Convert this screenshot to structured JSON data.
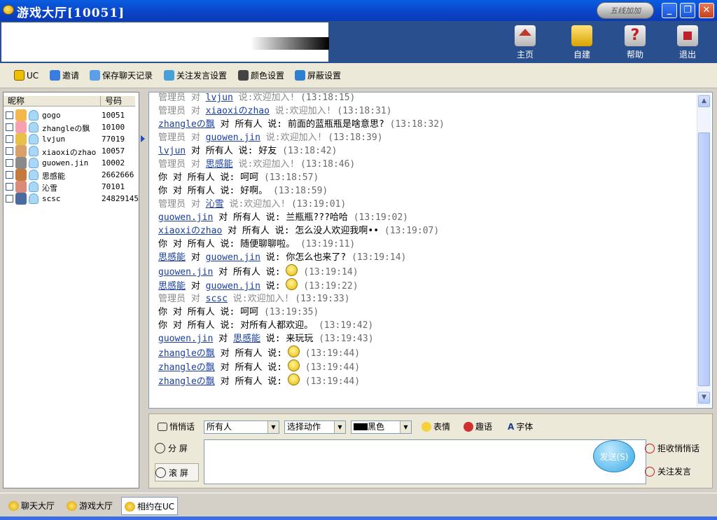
{
  "window": {
    "title": "游戏大厅[10051]",
    "brand": "五线加加",
    "minimize": "_",
    "maximize": "❐",
    "close": "✕"
  },
  "nav": [
    {
      "label": "主页",
      "icon": "home-icon"
    },
    {
      "label": "自建",
      "icon": "create-icon"
    },
    {
      "label": "帮助",
      "icon": "help-icon"
    },
    {
      "label": "退出",
      "icon": "exit-icon"
    }
  ],
  "toolbar": {
    "uc": "UC",
    "invite": "邀请",
    "save_chat": "保存聊天记录",
    "follow_settings": "关注发言设置",
    "color_settings": "颜色设置",
    "block_settings": "屏蔽设置"
  },
  "userlist": {
    "col_nick": "昵称",
    "col_id": "号码",
    "users": [
      {
        "name": "gogo",
        "id": "10051"
      },
      {
        "name": "zhangleの飘",
        "id": "10100"
      },
      {
        "name": "lvjun",
        "id": "77019"
      },
      {
        "name": "xiaoxiのzhao",
        "id": "10057"
      },
      {
        "name": "guowen.jin",
        "id": "10002"
      },
      {
        "name": "思感能",
        "id": "2662666"
      },
      {
        "name": "沁雪",
        "id": "70101"
      },
      {
        "name": "scsc",
        "id": "24829145"
      }
    ]
  },
  "chat": {
    "messages": [
      {
        "sys": true,
        "pre": "管理员 对 ",
        "user": "lvjun",
        "mid": "",
        "target": "",
        "text": " 说:欢迎加入!",
        "emoji": false,
        "time": "(13:18:15)"
      },
      {
        "sys": true,
        "pre": "管理员 对 ",
        "user": "xiaoxiのzhao",
        "mid": "",
        "target": "",
        "text": " 说:欢迎加入!",
        "emoji": false,
        "time": "(13:18:31)"
      },
      {
        "sys": false,
        "pre": "",
        "user": "zhangleの飘",
        "mid": " 对 所有人 说: ",
        "target": "",
        "text": "前面的蓝瓶瓶是啥意思?",
        "emoji": false,
        "time": "(13:18:32)"
      },
      {
        "sys": true,
        "pre": "管理员 对 ",
        "user": "guowen.jin",
        "mid": "",
        "target": "",
        "text": " 说:欢迎加入!",
        "emoji": false,
        "time": "(13:18:39)"
      },
      {
        "sys": false,
        "pre": "",
        "user": "lvjun",
        "mid": " 对 所有人 说: ",
        "target": "",
        "text": "好友",
        "emoji": false,
        "time": "(13:18:42)"
      },
      {
        "sys": true,
        "pre": "管理员 对 ",
        "user": "思感能",
        "mid": "",
        "target": "",
        "text": " 说:欢迎加入!",
        "emoji": false,
        "time": "(13:18:46)"
      },
      {
        "sys": false,
        "pre": "你 对 所有人 说: ",
        "user": "",
        "mid": "",
        "target": "",
        "text": "呵呵",
        "emoji": false,
        "time": "(13:18:57)"
      },
      {
        "sys": false,
        "pre": "你 对 所有人 说: ",
        "user": "",
        "mid": "",
        "target": "",
        "text": "好啊。",
        "emoji": false,
        "time": "(13:18:59)"
      },
      {
        "sys": true,
        "pre": "管理员 对 ",
        "user": "沁雪",
        "mid": "",
        "target": "",
        "text": " 说:欢迎加入!",
        "emoji": false,
        "time": "(13:19:01)"
      },
      {
        "sys": false,
        "pre": "",
        "user": "guowen.jin",
        "mid": " 对 所有人 说: ",
        "target": "",
        "text": "兰瓶瓶???哈哈",
        "emoji": false,
        "time": "(13:19:02)"
      },
      {
        "sys": false,
        "pre": "",
        "user": "xiaoxiのzhao",
        "mid": " 对 所有人 说: ",
        "target": "",
        "text": "怎么没人欢迎我啊••",
        "emoji": false,
        "time": "(13:19:07)"
      },
      {
        "sys": false,
        "pre": "你 对 所有人 说: ",
        "user": "",
        "mid": "",
        "target": "",
        "text": "随便聊聊啦。",
        "emoji": false,
        "time": "(13:19:11)"
      },
      {
        "sys": false,
        "pre": "",
        "user": "思感能",
        "mid": " 对 ",
        "target": "guowen.jin",
        "text": " 说: 你怎么也来了?",
        "emoji": false,
        "time": "(13:19:14)"
      },
      {
        "sys": false,
        "pre": "",
        "user": "guowen.jin",
        "mid": " 对 所有人 说: ",
        "target": "",
        "text": "",
        "emoji": true,
        "time": "(13:19:14)"
      },
      {
        "sys": false,
        "pre": "",
        "user": "思感能",
        "mid": " 对 ",
        "target": "guowen.jin",
        "text": " 说: ",
        "emoji": true,
        "time": "(13:19:22)"
      },
      {
        "sys": true,
        "pre": "管理员 对 ",
        "user": "scsc",
        "mid": "",
        "target": "",
        "text": " 说:欢迎加入!",
        "emoji": false,
        "time": "(13:19:33)"
      },
      {
        "sys": false,
        "pre": "你 对 所有人 说: ",
        "user": "",
        "mid": "",
        "target": "",
        "text": "呵呵",
        "emoji": false,
        "time": "(13:19:35)"
      },
      {
        "sys": false,
        "pre": "你 对 所有人 说: ",
        "user": "",
        "mid": "",
        "target": "",
        "text": "对所有人都欢迎。",
        "emoji": false,
        "time": "(13:19:42)"
      },
      {
        "sys": false,
        "pre": "",
        "user": "guowen.jin",
        "mid": " 对 ",
        "target": "思感能",
        "text": " 说: 来玩玩",
        "emoji": false,
        "time": "(13:19:43)"
      },
      {
        "sys": false,
        "pre": "",
        "user": "zhangleの飘",
        "mid": " 对 所有人 说: ",
        "target": "",
        "text": "",
        "emoji": true,
        "time": "(13:19:44)"
      },
      {
        "sys": false,
        "pre": "",
        "user": "zhangleの飘",
        "mid": " 对 所有人 说: ",
        "target": "",
        "text": "",
        "emoji": true,
        "time": "(13:19:44)"
      },
      {
        "sys": false,
        "pre": "",
        "user": "zhangleの飘",
        "mid": " 对 所有人 说: ",
        "target": "",
        "text": "",
        "emoji": true,
        "time": "(13:19:44)"
      }
    ]
  },
  "input": {
    "whisper": "悄悄话",
    "recipient": "所有人",
    "action": "选择动作",
    "color": "黑色",
    "emoticon": "表情",
    "fun": "趣语",
    "font": "字体",
    "split_screen": "分  屏",
    "scroll_screen": "滚  屏",
    "send": "发送(S)",
    "reject_whisper": "拒收悄悄话",
    "follow_speech": "关注发言",
    "message": ""
  },
  "taskbar": [
    {
      "label": "聊天大厅",
      "active": false
    },
    {
      "label": "游戏大厅",
      "active": false
    },
    {
      "label": "相约在UC",
      "active": true
    }
  ]
}
